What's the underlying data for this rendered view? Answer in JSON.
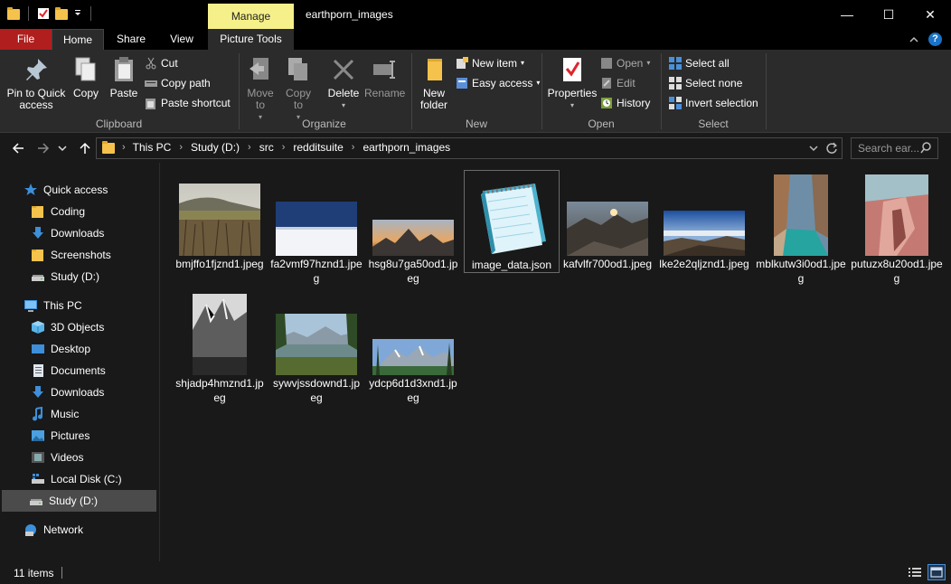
{
  "window": {
    "title": "earthporn_images",
    "manage_tab": "Manage",
    "controls": {
      "minimize": "—",
      "maximize": "☐",
      "close": "✕"
    }
  },
  "tabs": {
    "file": "File",
    "home": "Home",
    "share": "Share",
    "view": "View",
    "picture_tools": "Picture Tools"
  },
  "ribbon": {
    "clipboard": {
      "label": "Clipboard",
      "pin": "Pin to Quick access",
      "copy": "Copy",
      "paste": "Paste",
      "cut": "Cut",
      "copy_path": "Copy path",
      "paste_shortcut": "Paste shortcut"
    },
    "organize": {
      "label": "Organize",
      "move_to": "Move to",
      "copy_to": "Copy to",
      "delete": "Delete",
      "rename": "Rename"
    },
    "new": {
      "label": "New",
      "new_folder": "New folder",
      "new_item": "New item",
      "easy_access": "Easy access"
    },
    "open": {
      "label": "Open",
      "properties": "Properties",
      "open": "Open",
      "edit": "Edit",
      "history": "History"
    },
    "select": {
      "label": "Select",
      "select_all": "Select all",
      "select_none": "Select none",
      "invert_selection": "Invert selection"
    }
  },
  "address": {
    "crumbs": [
      "This PC",
      "Study (D:)",
      "src",
      "redditsuite",
      "earthporn_images"
    ],
    "search_placeholder": "Search ear..."
  },
  "nav": [
    {
      "label": "Quick access",
      "icon": "star-icon"
    },
    {
      "label": "Coding",
      "icon": "folder-icon"
    },
    {
      "label": "Downloads",
      "icon": "download-icon"
    },
    {
      "label": "Screenshots",
      "icon": "folder-icon"
    },
    {
      "label": "Study (D:)",
      "icon": "drive-icon"
    },
    {
      "label": "This PC",
      "icon": "monitor-icon"
    },
    {
      "label": "3D Objects",
      "icon": "cube-icon"
    },
    {
      "label": "Desktop",
      "icon": "desktop-icon"
    },
    {
      "label": "Documents",
      "icon": "document-icon"
    },
    {
      "label": "Downloads",
      "icon": "download-icon"
    },
    {
      "label": "Music",
      "icon": "music-icon"
    },
    {
      "label": "Pictures",
      "icon": "pictures-icon"
    },
    {
      "label": "Videos",
      "icon": "video-icon"
    },
    {
      "label": "Local Disk (C:)",
      "icon": "windows-drive-icon"
    },
    {
      "label": "Study (D:)",
      "icon": "drive-icon"
    },
    {
      "label": "Network",
      "icon": "network-icon"
    }
  ],
  "files": [
    {
      "name": "bmjffo1fjznd1.jpeg"
    },
    {
      "name": "fa2vmf97hznd1.jpeg"
    },
    {
      "name": "hsg8u7ga50od1.jpeg"
    },
    {
      "name": "image_data.json"
    },
    {
      "name": "kafvlfr700od1.jpeg"
    },
    {
      "name": "lke2e2qljznd1.jpeg"
    },
    {
      "name": "mblkutw3i0od1.jpeg"
    },
    {
      "name": "putuzx8u20od1.jpeg"
    },
    {
      "name": "shjadp4hmznd1.jpeg"
    },
    {
      "name": "sywvjssdownd1.jpeg"
    },
    {
      "name": "ydcp6d1d3xnd1.jpeg"
    }
  ],
  "status": {
    "item_count": "11 items"
  }
}
